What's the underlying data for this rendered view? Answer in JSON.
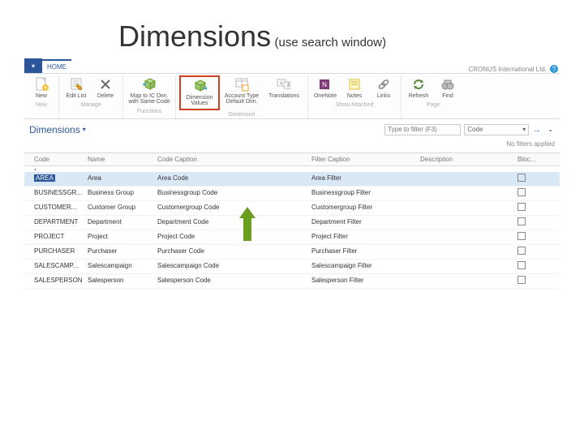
{
  "slide": {
    "title": "Dimensions",
    "subtitle": "(use search window)"
  },
  "header": {
    "home_tab": "HOME",
    "company": "CRONUS International Ltd."
  },
  "ribbon": {
    "new_group": {
      "new": "New",
      "label": "New"
    },
    "manage_group": {
      "edit_list": "Edit List",
      "delete": "Delete",
      "label": "Manage"
    },
    "functions_group": {
      "map": "Map to IC Dim. with Same Code",
      "label": "Functions"
    },
    "dimension_group": {
      "values": "Dimension Values",
      "acct_default": "Account Type Default Dim.",
      "translations": "Translations",
      "label": "Dimension"
    },
    "attached_group": {
      "onenote": "OneNote",
      "notes": "Notes",
      "links": "Links",
      "label": "Show Attached"
    },
    "page_group": {
      "refresh": "Refresh",
      "find": "Find",
      "label": "Page"
    }
  },
  "subheader": {
    "title": "Dimensions"
  },
  "filter": {
    "placeholder": "Type to filter (F3)",
    "field": "Code",
    "status": "No filters applied"
  },
  "columns": {
    "code": "Code",
    "name": "Name",
    "code_caption": "Code Caption",
    "filter_caption": "Filter Caption",
    "description": "Description",
    "blocked": "Bloc..."
  },
  "rows": [
    {
      "code": "AREA",
      "name": "Area",
      "code_caption": "Area Code",
      "filter_caption": "Area Filter"
    },
    {
      "code": "BUSINESSGR...",
      "name": "Business Group",
      "code_caption": "Businessgroup Code",
      "filter_caption": "Businessgroup Filter"
    },
    {
      "code": "CUSTOMER...",
      "name": "Customer Group",
      "code_caption": "Customergroup Code",
      "filter_caption": "Customergroup Filter"
    },
    {
      "code": "DEPARTMENT",
      "name": "Department",
      "code_caption": "Department Code",
      "filter_caption": "Department Filter"
    },
    {
      "code": "PROJECT",
      "name": "Project",
      "code_caption": "Project Code",
      "filter_caption": "Project Filter"
    },
    {
      "code": "PURCHASER",
      "name": "Purchaser",
      "code_caption": "Purchaser Code",
      "filter_caption": "Purchaser Filter"
    },
    {
      "code": "SALESCAMP...",
      "name": "Salescampaign",
      "code_caption": "Salescampaign Code",
      "filter_caption": "Salescampaign Filter"
    },
    {
      "code": "SALESPERSON",
      "name": "Salesperson",
      "code_caption": "Salesperson Code",
      "filter_caption": "Salesperson Filter"
    }
  ]
}
